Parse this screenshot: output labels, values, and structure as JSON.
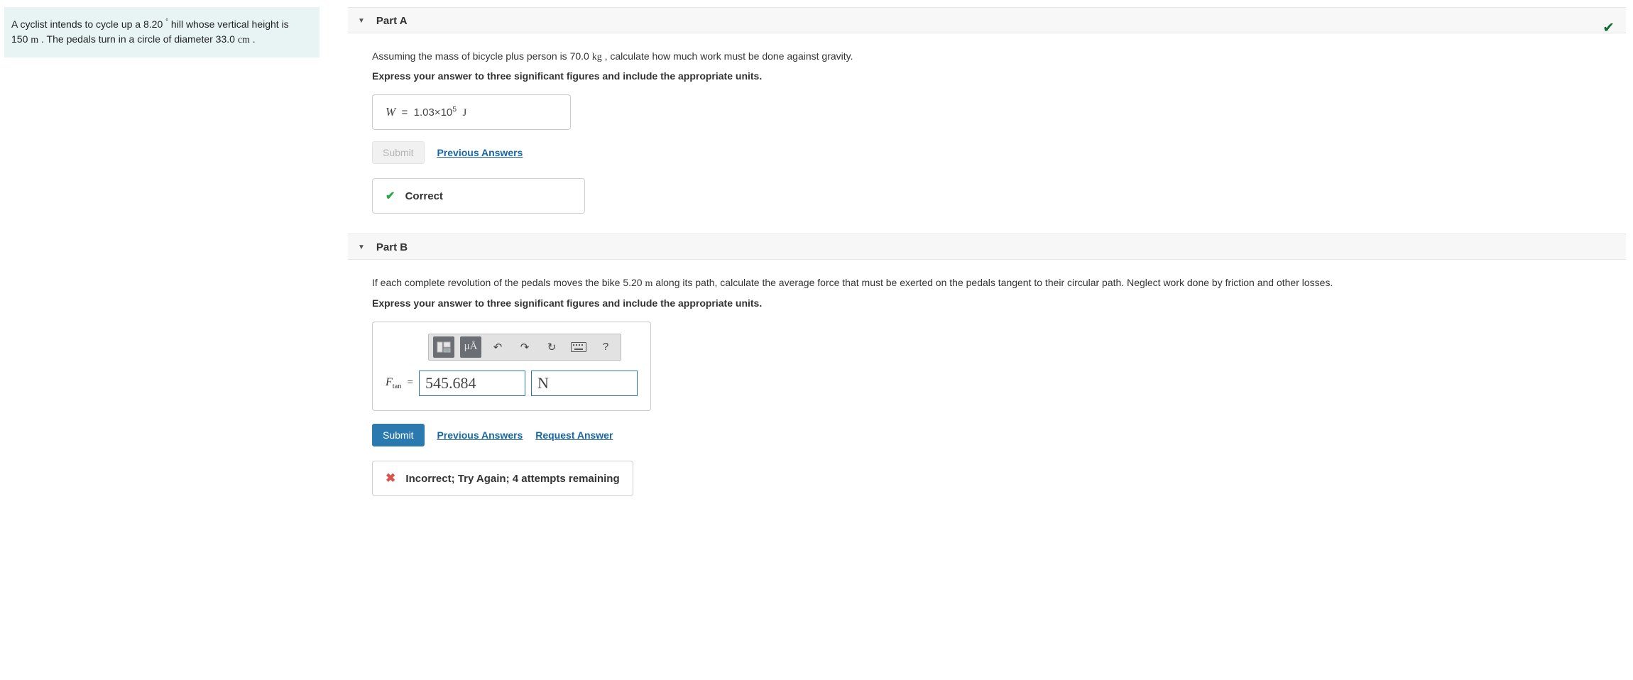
{
  "problem_intro_html": "A cyclist intends to cycle up a 8.20 ° hill whose vertical height is 150 m . The pedals turn in a circle of diameter 33.0 cm .",
  "part_a": {
    "title": "Part A",
    "instruction": "Assuming the mass of bicycle plus person is 70.0 kg , calculate how much work must be done against gravity.",
    "instruction_bold": "Express your answer to three significant figures and include the appropriate units.",
    "answer_var": "W",
    "answer_value_prefix": "1.03×10",
    "answer_value_exp": "5",
    "answer_unit": "J",
    "submit_label": "Submit",
    "prev_answers_label": "Previous Answers",
    "feedback_label": "Correct"
  },
  "part_b": {
    "title": "Part B",
    "instruction": "If each complete revolution of the pedals moves the bike 5.20 m along its path, calculate the average force that must be exerted on the pedals tangent to their circular path. Neglect work done by friction and other losses.",
    "instruction_bold": "Express your answer to three significant figures and include the appropriate units.",
    "var_label_main": "F",
    "var_label_sub": "tan",
    "eq": "=",
    "value_input": "545.684",
    "unit_input": "N",
    "toolbar": {
      "templates": "templates",
      "symbols": "μÅ",
      "undo": "↶",
      "redo": "↷",
      "reset": "↻",
      "keyboard": "⌨",
      "help": "?"
    },
    "submit_label": "Submit",
    "prev_answers_label": "Previous Answers",
    "request_answer_label": "Request Answer",
    "feedback_label": "Incorrect; Try Again; 4 attempts remaining"
  }
}
